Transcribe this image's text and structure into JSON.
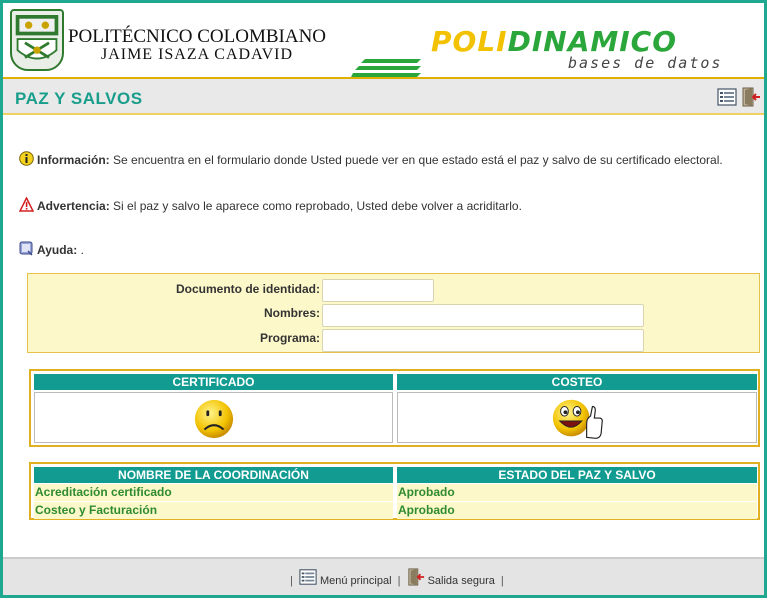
{
  "header": {
    "institution_name": "POLITÉCNICO COLOMBIANO",
    "institution_subtitle": "JAIME ISAZA CADAVID",
    "brand_part1": "POLI",
    "brand_part2": "DINAMICO",
    "brand_subtitle": "bases de datos",
    "icons": [
      "crest-logo",
      "brand-stripes"
    ]
  },
  "titlebar": {
    "title": "PAZ Y SALVOS",
    "icons": [
      "menu-list-icon",
      "exit-door-icon"
    ]
  },
  "messages": {
    "info_label": "Información:",
    "info_text": " Se encuentra en el formulario donde Usted puede ver en que estado está el paz y salvo de su certificado electoral.",
    "warning_label": "Advertencia:",
    "warning_text": " Si el paz y salvo le aparece como reprobado, Usted debe volver a acriditarlo.",
    "help_label": "Ayuda:",
    "help_text": " ."
  },
  "form": {
    "doc_label": "Documento de identidad:",
    "doc_value": "",
    "names_label": "Nombres:",
    "names_value": "",
    "program_label": "Programa:",
    "program_value": ""
  },
  "status_table": {
    "headers": [
      "CERTIFICADO",
      "COSTEO"
    ],
    "certificado_icon": "sad-face-icon",
    "costeo_icon": "thumbs-up-face-icon"
  },
  "coordination_table": {
    "headers": [
      "NOMBRE DE LA COORDINACIÓN",
      "ESTADO DEL PAZ Y SALVO"
    ],
    "rows": [
      {
        "name": "Acreditación certificado",
        "status": "Aprobado"
      },
      {
        "name": "Costeo y Facturación",
        "status": "Aprobado"
      }
    ]
  },
  "footer": {
    "sep": "|",
    "menu_label": "Menú principal",
    "exit_label": "Salida segura"
  },
  "colors": {
    "teal": "#119b91",
    "title_teal": "#1a9e8c",
    "pale_yellow": "#fcf8c9",
    "gold_border": "#e0b020",
    "approved_green": "#2e8b2e"
  }
}
